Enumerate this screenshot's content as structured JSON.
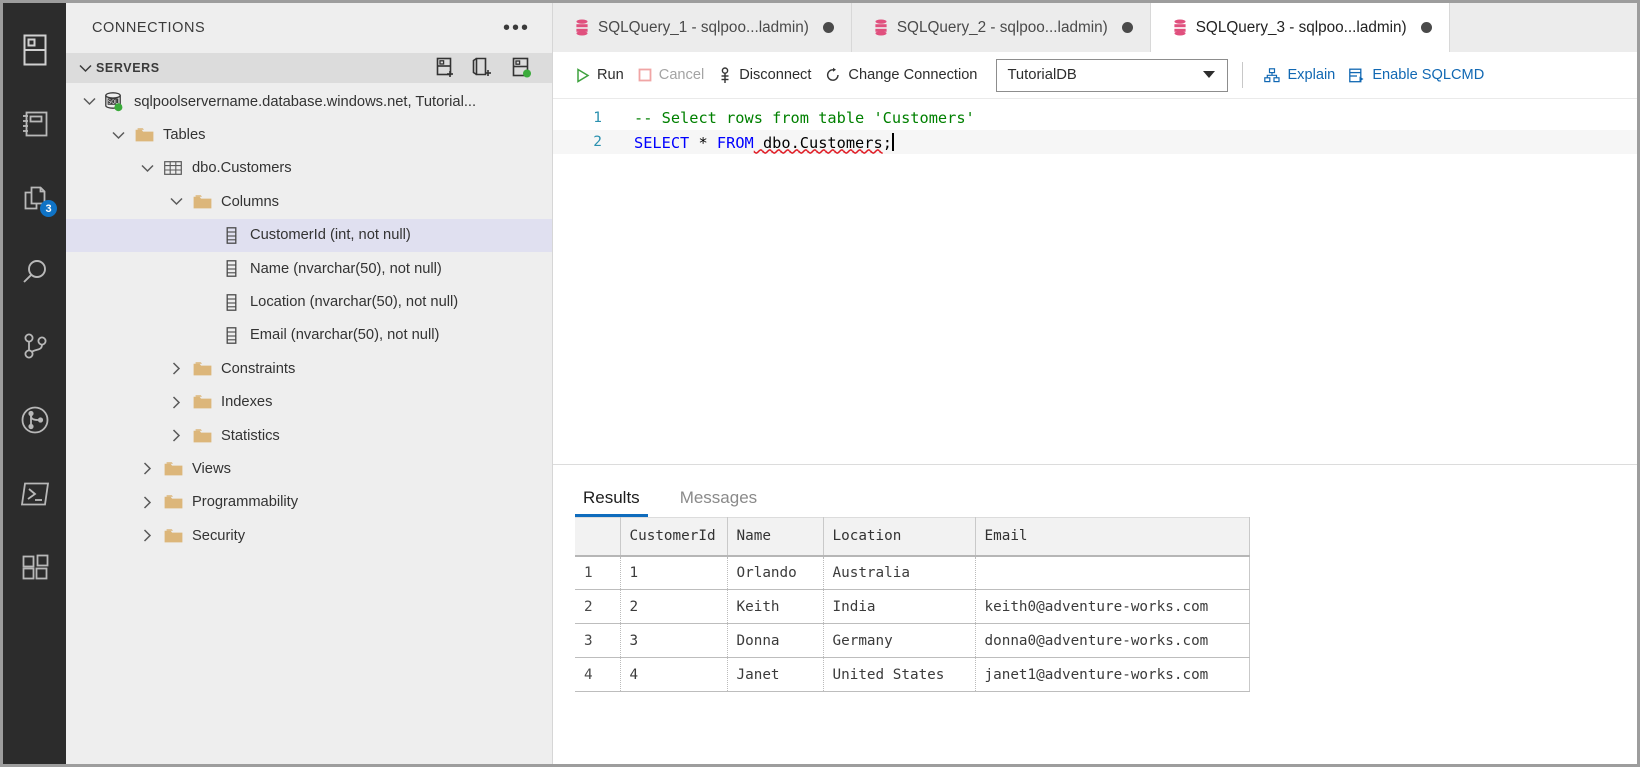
{
  "activity_bar": {
    "items": [
      {
        "name": "connections-icon",
        "title": "Connections"
      },
      {
        "name": "notebooks-icon",
        "title": "Notebooks"
      },
      {
        "name": "explorer-icon",
        "title": "Explorer",
        "badge": "3"
      },
      {
        "name": "search-icon",
        "title": "Search"
      },
      {
        "name": "source-control-icon",
        "title": "Source Control"
      },
      {
        "name": "git-graph-icon",
        "title": "Git Graph"
      },
      {
        "name": "terminal-icon",
        "title": "Terminal"
      },
      {
        "name": "extensions-icon",
        "title": "Extensions"
      }
    ]
  },
  "sidebar": {
    "title": "CONNECTIONS",
    "more_actions": "•••",
    "section": {
      "label": "SERVERS",
      "actions": [
        "new-connection-icon",
        "new-query-icon",
        "new-server-group-icon"
      ]
    },
    "tree": [
      {
        "label": "sqlpoolservername.database.windows.net, Tutorial...",
        "indent": 0,
        "twisty": "down",
        "icon": "sql-server-icon",
        "selected": false
      },
      {
        "label": "Tables",
        "indent": 1,
        "twisty": "down",
        "icon": "folder-icon",
        "selected": false
      },
      {
        "label": "dbo.Customers",
        "indent": 2,
        "twisty": "down",
        "icon": "table-icon",
        "selected": false
      },
      {
        "label": "Columns",
        "indent": 3,
        "twisty": "down",
        "icon": "folder-icon",
        "selected": false
      },
      {
        "label": "CustomerId (int, not null)",
        "indent": 4,
        "twisty": "none",
        "icon": "column-icon",
        "selected": true
      },
      {
        "label": "Name (nvarchar(50), not null)",
        "indent": 4,
        "twisty": "none",
        "icon": "column-icon",
        "selected": false
      },
      {
        "label": "Location (nvarchar(50), not null)",
        "indent": 4,
        "twisty": "none",
        "icon": "column-icon",
        "selected": false
      },
      {
        "label": "Email (nvarchar(50), not null)",
        "indent": 4,
        "twisty": "none",
        "icon": "column-icon",
        "selected": false
      },
      {
        "label": "Constraints",
        "indent": 3,
        "twisty": "right",
        "icon": "folder-icon",
        "selected": false
      },
      {
        "label": "Indexes",
        "indent": 3,
        "twisty": "right",
        "icon": "folder-icon",
        "selected": false
      },
      {
        "label": "Statistics",
        "indent": 3,
        "twisty": "right",
        "icon": "folder-icon",
        "selected": false
      },
      {
        "label": "Views",
        "indent": 2,
        "twisty": "right",
        "icon": "folder-icon",
        "selected": false
      },
      {
        "label": "Programmability",
        "indent": 2,
        "twisty": "right",
        "icon": "folder-icon",
        "selected": false
      },
      {
        "label": "Security",
        "indent": 2,
        "twisty": "right",
        "icon": "folder-icon",
        "selected": false
      }
    ]
  },
  "editor_tabs": [
    {
      "label": "SQLQuery_1 - sqlpoo...ladmin)",
      "active": false,
      "dirty": true,
      "icon": "database-icon"
    },
    {
      "label": "SQLQuery_2 - sqlpoo...ladmin)",
      "active": false,
      "dirty": true,
      "icon": "database-icon"
    },
    {
      "label": "SQLQuery_3 - sqlpoo...ladmin)",
      "active": true,
      "dirty": true,
      "icon": "database-icon"
    }
  ],
  "query_toolbar": {
    "run": "Run",
    "cancel": "Cancel",
    "disconnect": "Disconnect",
    "change_connection": "Change Connection",
    "database": "TutorialDB",
    "explain": "Explain",
    "enable_sqlcmd": "Enable SQLCMD"
  },
  "editor": {
    "lines": [
      {
        "no": "1",
        "comment": "-- Select rows from table 'Customers'"
      },
      {
        "no": "2",
        "kw1": "SELECT",
        "star": " * ",
        "kw2": "FROM",
        "object": " dbo.Customers",
        "semi": ";"
      }
    ]
  },
  "results": {
    "tabs": [
      {
        "label": "Results",
        "active": true
      },
      {
        "label": "Messages",
        "active": false
      }
    ],
    "columns": [
      "CustomerId",
      "Name",
      "Location",
      "Email"
    ],
    "rows": [
      {
        "n": "1",
        "cells": [
          "1",
          "Orlando",
          "Australia",
          ""
        ]
      },
      {
        "n": "2",
        "cells": [
          "2",
          "Keith",
          "India",
          "keith0@adventure-works.com"
        ]
      },
      {
        "n": "3",
        "cells": [
          "3",
          "Donna",
          "Germany",
          "donna0@adventure-works.com"
        ]
      },
      {
        "n": "4",
        "cells": [
          "4",
          "Janet",
          "United States",
          "janet1@adventure-works.com"
        ]
      }
    ]
  },
  "colors": {
    "accent": "#0f6cbd",
    "link": "#1168b3",
    "badge": "#0f73c6",
    "connected_dot": "#3bab3b",
    "tab_db_icon": "#e0507e",
    "run_green": "#3fa23f",
    "cancel_pink": "#f0a5a5",
    "comment_green": "#008000",
    "keyword_blue": "#0000ff",
    "error_red": "#e01b24",
    "folder_tan": "#dcb67a",
    "activitybar_bg": "#2c2c2c",
    "sidebar_bg": "#eeeeee"
  }
}
